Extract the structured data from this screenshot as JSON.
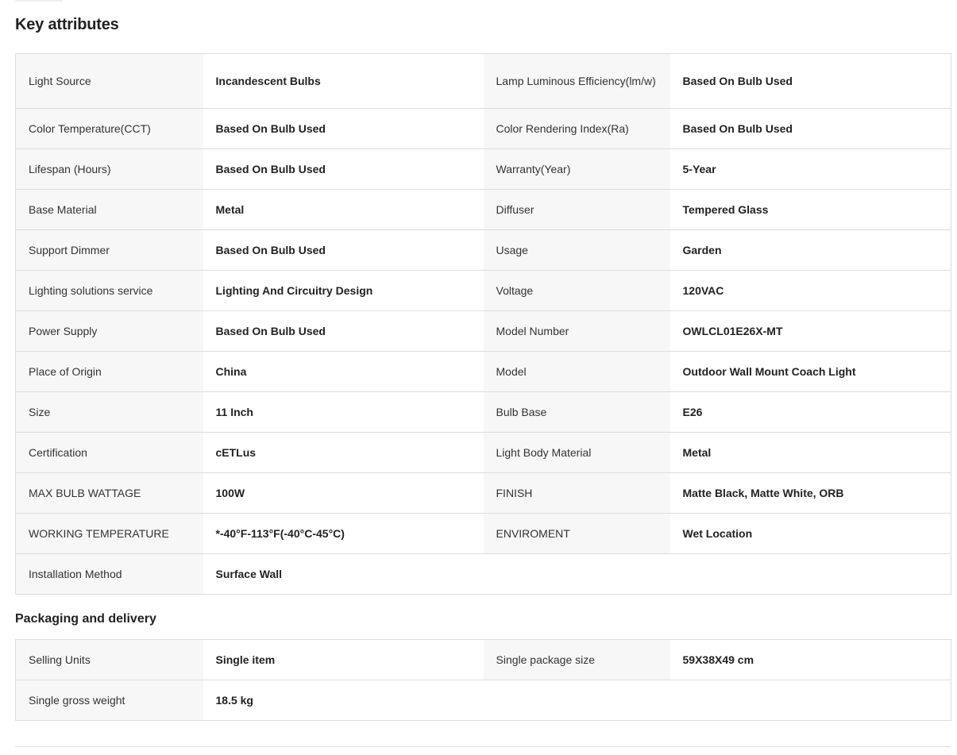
{
  "key_attributes": {
    "title": "Key attributes",
    "rows": [
      {
        "k1": "Light Source",
        "v1": "Incandescent Bulbs",
        "k2": "Lamp Luminous Efficiency(lm/w)",
        "v2": "Based On Bulb Used"
      },
      {
        "k1": "Color Temperature(CCT)",
        "v1": "Based On Bulb Used",
        "k2": "Color Rendering Index(Ra)",
        "v2": "Based On Bulb Used"
      },
      {
        "k1": "Lifespan (Hours)",
        "v1": "Based On Bulb Used",
        "k2": "Warranty(Year)",
        "v2": "5-Year"
      },
      {
        "k1": "Base Material",
        "v1": "Metal",
        "k2": "Diffuser",
        "v2": "Tempered Glass"
      },
      {
        "k1": "Support Dimmer",
        "v1": "Based On Bulb Used",
        "k2": "Usage",
        "v2": "Garden"
      },
      {
        "k1": "Lighting solutions service",
        "v1": "Lighting And Circuitry Design",
        "k2": "Voltage",
        "v2": "120VAC"
      },
      {
        "k1": "Power Supply",
        "v1": "Based On Bulb Used",
        "k2": "Model Number",
        "v2": "OWLCL01E26X-MT"
      },
      {
        "k1": "Place of Origin",
        "v1": "China",
        "k2": "Model",
        "v2": "Outdoor Wall Mount Coach Light"
      },
      {
        "k1": "Size",
        "v1": "11 Inch",
        "k2": "Bulb Base",
        "v2": "E26"
      },
      {
        "k1": "Certification",
        "v1": "cETLus",
        "k2": "Light Body Material",
        "v2": "Metal"
      },
      {
        "k1": "MAX BULB WATTAGE",
        "v1": "100W",
        "k2": "FINISH",
        "v2": "Matte Black, Matte White, ORB"
      },
      {
        "k1": "WORKING TEMPERATURE",
        "v1": "*-40°F-113°F(-40°C-45°C)",
        "k2": "ENVIROMENT",
        "v2": "Wet Location"
      },
      {
        "k1": "Installation Method",
        "v1": "Surface Wall"
      }
    ]
  },
  "packaging": {
    "title": "Packaging and delivery",
    "rows": [
      {
        "k1": "Selling Units",
        "v1": "Single item",
        "k2": "Single package size",
        "v2": "59X38X49 cm"
      },
      {
        "k1": "Single gross weight",
        "v1": "18.5 kg"
      }
    ]
  }
}
